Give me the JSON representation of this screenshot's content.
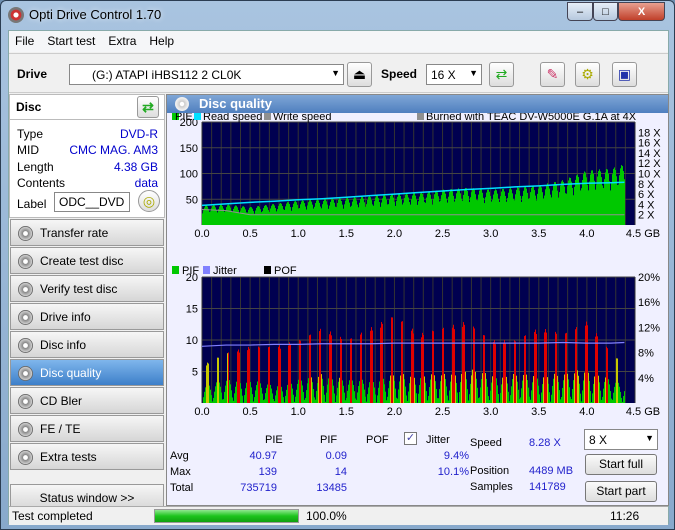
{
  "window": {
    "title": "Opti Drive Control 1.70",
    "minimize": "–",
    "maximize": "□",
    "close": "X"
  },
  "menu": [
    "File",
    "Start test",
    "Extra",
    "Help"
  ],
  "toolbar": {
    "drive_label": "Drive",
    "drive_value": "(G:)  ATAPI iHBS112  2 CL0K",
    "speed_label": "Speed",
    "speed_value": "16 X"
  },
  "disc": {
    "header": "Disc",
    "fields": [
      {
        "k": "Type",
        "v": "DVD-R"
      },
      {
        "k": "MID",
        "v": "CMC MAG. AM3"
      },
      {
        "k": "Length",
        "v": "4.38 GB"
      },
      {
        "k": "Contents",
        "v": "data"
      }
    ],
    "label_key": "Label",
    "label_value": "ODC__DVD"
  },
  "nav": [
    "Transfer rate",
    "Create test disc",
    "Verify test disc",
    "Drive info",
    "Disc info",
    "Disc quality",
    "CD Bler",
    "FE / TE",
    "Extra tests"
  ],
  "nav_active": "Disc quality",
  "status_window": "Status window >>",
  "panel_title": "Disc quality",
  "colors": {
    "pie": "#00c800",
    "read": "#00e0ff",
    "write": "#909090",
    "pif_low": "#00c800",
    "pif_mid": "#c8c800",
    "pif_high": "#e00000",
    "jitter": "#8080ff",
    "plot_bg": "#000050"
  },
  "chart_data": [
    {
      "type": "bar",
      "legend": [
        "PIE",
        "Read speed",
        "Write speed"
      ],
      "annotation": "Burned with TEAC DV-W5000E G.1A at 4X",
      "x_ticks": [
        "0.0",
        "0.5",
        "1.0",
        "1.5",
        "2.0",
        "2.5",
        "3.0",
        "3.5",
        "4.0",
        "4.5 GB"
      ],
      "xlim": [
        0,
        4.5
      ],
      "ylim": [
        0,
        200
      ],
      "y_ticks": [
        "50",
        "100",
        "150",
        "200"
      ],
      "y2_ticks": [
        "2 X",
        "4 X",
        "6 X",
        "8 X",
        "10 X",
        "12 X",
        "14 X",
        "16 X",
        "18 X"
      ],
      "y2lim": [
        0,
        20
      ],
      "x": [
        0,
        0.25,
        0.5,
        0.75,
        1.0,
        1.25,
        1.5,
        1.75,
        2.0,
        2.25,
        2.5,
        2.75,
        3.0,
        3.25,
        3.5,
        3.75,
        4.0,
        4.25,
        4.39
      ],
      "pie": [
        30,
        32,
        28,
        33,
        38,
        40,
        42,
        45,
        48,
        50,
        55,
        58,
        55,
        58,
        62,
        70,
        85,
        88,
        95
      ],
      "read_speed": [
        3.8,
        4.1,
        4.4,
        4.6,
        4.9,
        5.1,
        5.4,
        5.7,
        6.0,
        6.3,
        6.6,
        6.9,
        7.1,
        7.4,
        7.6,
        7.9,
        8.1,
        8.2,
        8.3
      ],
      "write_speed": [
        3.0,
        2.8,
        2.0,
        2.0,
        2.0,
        2.0,
        2.0,
        2.0,
        2.0,
        2.0,
        2.0,
        2.0,
        2.0,
        2.0,
        2.0,
        2.0,
        2.0,
        2.0,
        2.0
      ]
    },
    {
      "type": "bar",
      "legend": [
        "PIF",
        "Jitter",
        "POF"
      ],
      "x_ticks": [
        "0.0",
        "0.5",
        "1.0",
        "1.5",
        "2.0",
        "2.5",
        "3.0",
        "3.5",
        "4.0",
        "4.5 GB"
      ],
      "xlim": [
        0,
        4.5
      ],
      "ylim": [
        0,
        20
      ],
      "y_ticks": [
        "5",
        "10",
        "15",
        "20"
      ],
      "y2_ticks": [
        "4%",
        "8%",
        "12%",
        "16%",
        "20%"
      ],
      "y2lim": [
        0,
        20
      ],
      "x": [
        0,
        0.25,
        0.5,
        0.75,
        1.0,
        1.25,
        1.5,
        1.75,
        2.0,
        2.25,
        2.5,
        2.75,
        3.0,
        3.25,
        3.5,
        3.75,
        4.0,
        4.25,
        4.39
      ],
      "pif": [
        3,
        4,
        4,
        3,
        4,
        5,
        4,
        4,
        5,
        5,
        5,
        6,
        5,
        5,
        5,
        5,
        6,
        4,
        3
      ],
      "pif_max": [
        6,
        8,
        9,
        9,
        10,
        12,
        10,
        12,
        14,
        11,
        12,
        13,
        10,
        10,
        12,
        11,
        13,
        8,
        6
      ],
      "jitter": [
        9.0,
        9.2,
        9.2,
        9.3,
        9.3,
        9.4,
        9.4,
        9.4,
        9.5,
        9.5,
        9.5,
        9.5,
        9.5,
        9.5,
        9.5,
        9.6,
        9.5,
        9.5,
        9.6
      ]
    }
  ],
  "stats": {
    "headers": [
      "PIE",
      "PIF",
      "POF",
      "Jitter"
    ],
    "rows": [
      {
        "k": "Avg",
        "pie": "40.97",
        "pif": "0.09",
        "jitter": "9.4%"
      },
      {
        "k": "Max",
        "pie": "139",
        "pif": "14",
        "jitter": "10.1%"
      },
      {
        "k": "Total",
        "pie": "735719",
        "pif": "13485",
        "jitter": ""
      }
    ],
    "jitter_checked": true,
    "speed_k": "Speed",
    "speed_v": "8.28 X",
    "position_k": "Position",
    "position_v": "4489 MB",
    "samples_k": "Samples",
    "samples_v": "141789"
  },
  "controls": {
    "speed_select": "8 X",
    "start_full": "Start full",
    "start_part": "Start part"
  },
  "statusbar": {
    "text": "Test completed",
    "progress": 100.0,
    "progress_text": "100.0%",
    "time": "11:26"
  }
}
